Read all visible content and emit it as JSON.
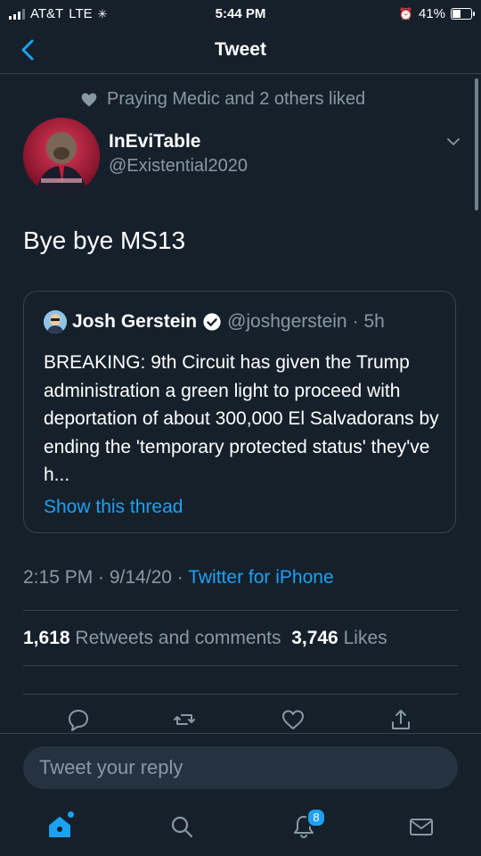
{
  "status_bar": {
    "carrier": "AT&T",
    "network": "LTE",
    "time": "5:44 PM",
    "battery_percent": "41%",
    "battery_level": 0.41
  },
  "nav": {
    "title": "Tweet"
  },
  "social_context": {
    "text": "Praying Medic and 2 others liked"
  },
  "tweet": {
    "author_name": "InEviTable",
    "author_handle": "@Existential2020",
    "text": "Bye bye MS13",
    "timestamp": "2:15 PM · 9/14/20 · ",
    "source": "Twitter for iPhone"
  },
  "quoted_tweet": {
    "author_name": "Josh Gerstein",
    "author_handle": "@joshgerstein",
    "time_ago": "· 5h",
    "text": "BREAKING: 9th Circuit has given the Trump administration a green light to proceed with deportation of about 300,000 El Salvadorans by ending the 'temporary protected status' they've h...",
    "show_thread": "Show this thread"
  },
  "stats": {
    "retweets_count": "1,618",
    "retweets_label": "Retweets and comments",
    "likes_count": "3,746",
    "likes_label": "Likes"
  },
  "reply": {
    "placeholder": "Tweet your reply"
  },
  "tabbar": {
    "notifications_badge": "8"
  },
  "colors": {
    "background": "#15202b",
    "accent": "#1da1f2",
    "secondary_text": "#8899a6",
    "border": "#38444d"
  }
}
